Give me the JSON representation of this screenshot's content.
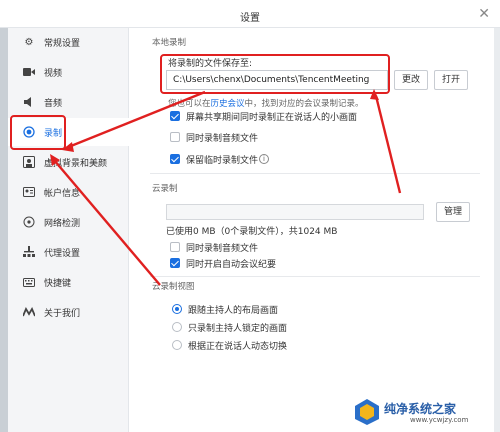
{
  "window": {
    "title": "设置"
  },
  "sidebar": {
    "items": [
      {
        "label": "常规设置",
        "icon": "gear-icon"
      },
      {
        "label": "视频",
        "icon": "video-icon"
      },
      {
        "label": "音频",
        "icon": "audio-icon"
      },
      {
        "label": "录制",
        "icon": "record-icon",
        "active": true
      },
      {
        "label": "虚拟背景和美颜",
        "icon": "portrait-icon"
      },
      {
        "label": "帐户信息",
        "icon": "account-icon"
      },
      {
        "label": "网络检测",
        "icon": "network-icon"
      },
      {
        "label": "代理设置",
        "icon": "proxy-icon"
      },
      {
        "label": "快捷键",
        "icon": "keyboard-icon"
      },
      {
        "label": "关于我们",
        "icon": "about-icon"
      }
    ]
  },
  "local": {
    "section_title": "本地录制",
    "save_label": "将录制的文件保存至:",
    "path_value": "C:\\Users\\chenx\\Documents\\TencentMeeting",
    "change_button": "更改",
    "open_button": "打开",
    "history_prefix": "您也可以在",
    "history_link": "历史会议",
    "history_suffix": "中，找到对应的会议录制记录。",
    "options": [
      {
        "label": "屏幕共享期间同时录制正在说话人的小画面",
        "checked": true
      },
      {
        "label": "同时录制音频文件",
        "checked": false
      },
      {
        "label": "保留临时录制文件",
        "checked": true
      }
    ]
  },
  "cloud": {
    "section_title": "云录制",
    "usage_text": "已使用0 MB（0个录制文件），共1024 MB",
    "manage_button": "管理",
    "options": [
      {
        "label": "同时录制音频文件",
        "checked": false
      },
      {
        "label": "同时开启自动会议纪要",
        "checked": true
      }
    ]
  },
  "view": {
    "section_title": "云录制视图",
    "options": [
      {
        "label": "跟随主持人的布局画面",
        "selected": true
      },
      {
        "label": "只录制主持人锁定的画面",
        "selected": false
      },
      {
        "label": "根据正在说话人动态切换",
        "selected": false
      }
    ]
  },
  "watermark": {
    "text": "纯净系统之家",
    "url": "www.ycwjzy.com"
  },
  "colors": {
    "accent": "#1a6fe0",
    "annotation": "#e02020"
  }
}
